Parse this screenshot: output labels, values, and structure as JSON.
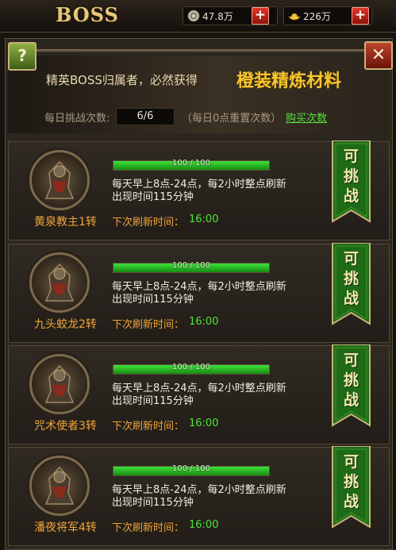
{
  "header": {
    "title": "BOSS",
    "silver": "47.8万",
    "gold": "226万"
  },
  "banner": {
    "text": "精英BOSS归属者，必然获得",
    "highlight": "橙装精炼材料"
  },
  "challenge": {
    "label": "每日挑战次数:",
    "value": "6/6",
    "reset_note": "（每日0点重置次数）",
    "buy_link": "购买次数"
  },
  "bosses": [
    {
      "name": "黄泉教主1转",
      "hp_text": "100 / 100",
      "hp_fraction": 1.0,
      "desc_line1": "每天早上8点-24点，每2小时整点刷新",
      "desc_line2": "出现时间115分钟",
      "next_label": "下次刷新时间：",
      "next_time": "16:00",
      "status": [
        "可",
        "挑",
        "战"
      ]
    },
    {
      "name": "九头蛟龙2转",
      "hp_text": "100 / 100",
      "hp_fraction": 1.0,
      "desc_line1": "每天早上8点-24点，每2小时整点刷新",
      "desc_line2": "出现时间115分钟",
      "next_label": "下次刷新时间：",
      "next_time": "16:00",
      "status": [
        "可",
        "挑",
        "战"
      ]
    },
    {
      "name": "咒术使者3转",
      "hp_text": "100 / 100",
      "hp_fraction": 1.0,
      "desc_line1": "每天早上8点-24点，每2小时整点刷新",
      "desc_line2": "出现时间115分钟",
      "next_label": "下次刷新时间：",
      "next_time": "16:00",
      "status": [
        "可",
        "挑",
        "战"
      ]
    },
    {
      "name": "潘夜将军4转",
      "hp_text": "100 / 100",
      "hp_fraction": 1.0,
      "desc_line1": "每天早上8点-24点，每2小时整点刷新",
      "desc_line2": "出现时间115分钟",
      "next_label": "下次刷新时间：",
      "next_time": "16:00",
      "status": [
        "可",
        "挑",
        "战"
      ]
    }
  ],
  "icons": {
    "help": "question-icon",
    "close": "close-icon",
    "silver": "coin-icon",
    "gold": "ingot-icon"
  },
  "colors": {
    "accent_gold": "#f7c62c",
    "hp_green": "#3fe23b",
    "name_orange": "#f0a43a",
    "link_green": "#55e33a",
    "flag_green": "#1f6a17"
  }
}
